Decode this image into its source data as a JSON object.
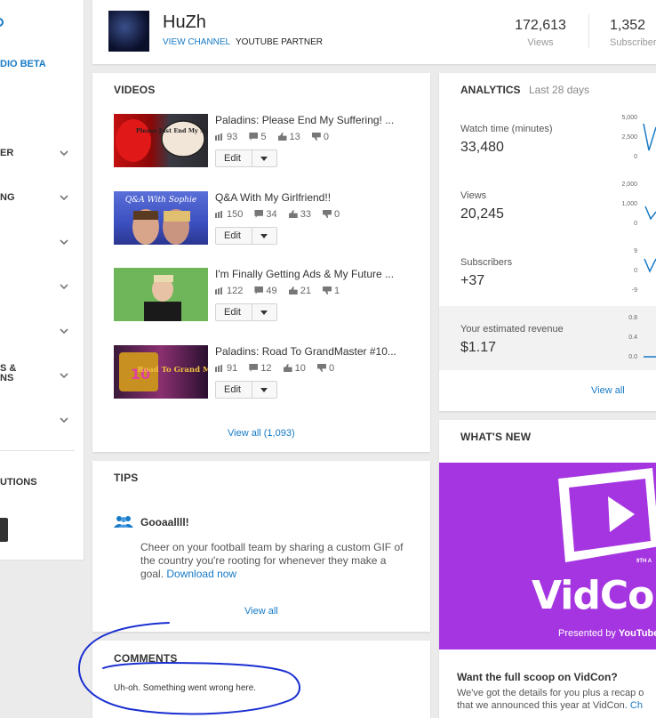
{
  "sidebar": {
    "beta_label": "DIO BETA",
    "items": [
      {
        "label": "ER",
        "top_label": ""
      },
      {
        "label": "NG",
        "top_label": ""
      },
      {
        "label": ""
      },
      {
        "label": ""
      },
      {
        "label": ""
      },
      {
        "label": "S &",
        "label2": "NS"
      },
      {
        "label": ""
      }
    ],
    "contributions_label": "UTIONS"
  },
  "header": {
    "channel_name": "HuZh",
    "view_channel": "VIEW CHANNEL",
    "partner": "YOUTUBE PARTNER",
    "views_count": "172,613",
    "views_label": "Views",
    "subscribers_count": "1,352",
    "subscribers_label": "Subscriber"
  },
  "videos": {
    "title": "VIDEOS",
    "edit_label": "Edit",
    "view_all": "View all (1,093)",
    "items": [
      {
        "title": "Paladins: Please End My Suffering! ...",
        "views": "93",
        "comments": "5",
        "likes": "13",
        "dislikes": "0",
        "thumb_caption": "Please Just End My Suffering"
      },
      {
        "title": "Q&A With My Girlfriend!!",
        "views": "150",
        "comments": "34",
        "likes": "33",
        "dislikes": "0",
        "thumb_caption": "Q&A With Sophie"
      },
      {
        "title": "I'm Finally Getting Ads & My Future ...",
        "views": "122",
        "comments": "49",
        "likes": "21",
        "dislikes": "1",
        "thumb_caption": ""
      },
      {
        "title": "Paladins: Road To GrandMaster #10...",
        "views": "91",
        "comments": "12",
        "likes": "10",
        "dislikes": "0",
        "thumb_caption": "Road To Grand Master"
      }
    ]
  },
  "tips": {
    "title": "TIPS",
    "heading": "Gooaallll!",
    "body": "Cheer on your football team by sharing a custom GIF of the country you're rooting for whenever they make a goal.",
    "link": "Download now",
    "view_all": "View all"
  },
  "comments": {
    "title": "COMMENTS",
    "error": "Uh-oh. Something went wrong here."
  },
  "analytics": {
    "title": "ANALYTICS",
    "period": "Last 28 days",
    "view_all": "View all",
    "metrics": [
      {
        "label": "Watch time (minutes)",
        "value": "33,480",
        "ticks": [
          "5,000",
          "2,500",
          "0"
        ]
      },
      {
        "label": "Views",
        "value": "20,245",
        "ticks": [
          "2,000",
          "1,000",
          "0"
        ]
      },
      {
        "label": "Subscribers",
        "value": "+37",
        "ticks": [
          "9",
          "0",
          "-9"
        ]
      },
      {
        "label": "Your estimated revenue",
        "value": "$1.17",
        "ticks": [
          "0.8",
          "0.4",
          "0.0"
        ]
      }
    ]
  },
  "whats_new": {
    "title": "WHAT'S NEW",
    "banner_logo": "VidCon",
    "banner_edition": "9TH A",
    "banner_presented": "Presented by",
    "banner_brand": "YouTube",
    "heading": "Want the full scoop on VidCon?",
    "body_line1": "We've got the details for you plus a recap o",
    "body_line2": "that we announced this year at VidCon.",
    "body_link": "Ch"
  },
  "colors": {
    "link": "#167ac6",
    "vidcon_purple": "#a535e0",
    "annotation": "#1a2fd0"
  }
}
